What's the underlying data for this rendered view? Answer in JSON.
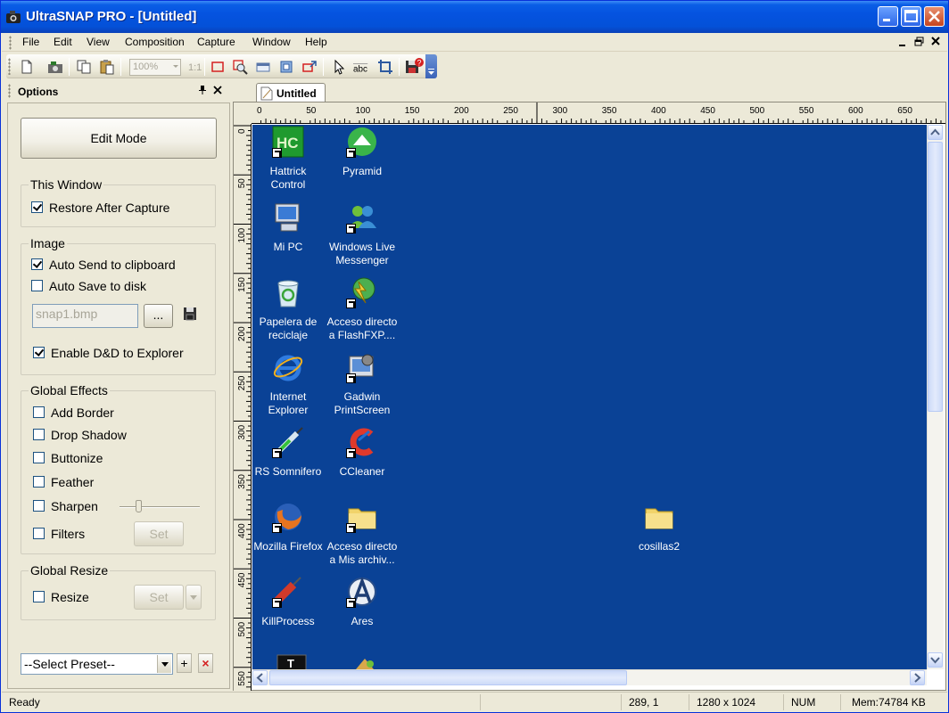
{
  "window": {
    "title": "UltraSNAP PRO - [Untitled]",
    "colors": {
      "titlebar": "#0553e0",
      "canvas": "#0a4296",
      "chrome": "#ece9d8"
    }
  },
  "menubar": {
    "items": [
      "File",
      "Edit",
      "View",
      "Composition",
      "Capture",
      "Window",
      "Help"
    ],
    "mnemonics": [
      "F",
      "E",
      "V",
      "C",
      "",
      "W",
      "H"
    ]
  },
  "toolbar": {
    "zoom": "100%",
    "ratio": "1:1",
    "tools": [
      "new-icon",
      "capture-icon",
      "copy-icon",
      "paste-icon",
      "rect-select-icon",
      "magnify-select-icon",
      "region-icon",
      "object-icon",
      "window-capture-icon",
      "pointer-icon",
      "text-tool-icon",
      "crop-icon",
      "save-icon"
    ]
  },
  "options": {
    "title": "Options",
    "edit_mode": "Edit Mode",
    "this_window": {
      "title": "This Window",
      "restore_after_capture": {
        "label": "Restore After Capture",
        "checked": true
      }
    },
    "image": {
      "title": "Image",
      "auto_send_clipboard": {
        "label": "Auto Send to clipboard",
        "checked": true
      },
      "auto_save_disk": {
        "label": "Auto Save to disk",
        "checked": false
      },
      "filename": "snap1.bmp",
      "browse": "...",
      "enable_dnd": {
        "label": "Enable D&D to Explorer",
        "checked": true
      }
    },
    "global_effects": {
      "title": "Global Effects",
      "add_border": {
        "label": "Add Border",
        "checked": false
      },
      "drop_shadow": {
        "label": "Drop Shadow",
        "checked": false
      },
      "buttonize": {
        "label": "Buttonize",
        "checked": false
      },
      "feather": {
        "label": "Feather",
        "checked": false
      },
      "sharpen": {
        "label": "Sharpen",
        "checked": false,
        "level": 0.08
      },
      "filters": {
        "label": "Filters",
        "checked": false
      },
      "set": "Set"
    },
    "global_resize": {
      "title": "Global Resize",
      "resize": {
        "label": "Resize",
        "checked": false
      },
      "set": "Set"
    },
    "preset": {
      "selected": "--Select Preset--",
      "add": "+",
      "delete": "×"
    }
  },
  "document": {
    "tab": "Untitled",
    "ruler_h": [
      "0",
      "50",
      "100",
      "150",
      "200",
      "250",
      "300",
      "350",
      "400",
      "450",
      "500",
      "550",
      "600",
      "650"
    ],
    "ruler_v": [
      "0",
      "50",
      "100",
      "150",
      "200",
      "250",
      "300",
      "350",
      "400",
      "450",
      "500",
      "550"
    ]
  },
  "desktop_icons": [
    {
      "label1": "Hattrick",
      "label2": "Control",
      "icon": "hattrick-icon"
    },
    {
      "label1": "Pyramid",
      "label2": "",
      "icon": "pyramid-icon"
    },
    {
      "label1": "Mi PC",
      "label2": "",
      "icon": "my-computer-icon"
    },
    {
      "label1": "Windows Live",
      "label2": "Messenger",
      "icon": "messenger-icon"
    },
    {
      "label1": "Papelera de",
      "label2": "reciclaje",
      "icon": "recycle-bin-icon"
    },
    {
      "label1": "Acceso directo",
      "label2": "a FlashFXP....",
      "icon": "flashfxp-icon"
    },
    {
      "label1": "Internet",
      "label2": "Explorer",
      "icon": "internet-explorer-icon"
    },
    {
      "label1": "Gadwin",
      "label2": "PrintScreen",
      "icon": "gadwin-icon"
    },
    {
      "label1": "RS Somnifero",
      "label2": "",
      "icon": "syringe-icon"
    },
    {
      "label1": "CCleaner",
      "label2": "",
      "icon": "ccleaner-icon"
    },
    {
      "label1": "Mozilla Firefox",
      "label2": "",
      "icon": "firefox-icon"
    },
    {
      "label1": "Acceso directo",
      "label2": "a Mis archiv...",
      "icon": "folder-shortcut-icon"
    },
    {
      "label1": "cosillas2",
      "label2": "",
      "icon": "folder-icon"
    },
    {
      "label1": "KillProcess",
      "label2": "",
      "icon": "killprocess-icon"
    },
    {
      "label1": "Ares",
      "label2": "",
      "icon": "ares-icon"
    }
  ],
  "statusbar": {
    "ready": "Ready",
    "coords": "289, 1",
    "size": "1280 x 1024",
    "num": "NUM",
    "mem": "Mem:74784 KB"
  }
}
